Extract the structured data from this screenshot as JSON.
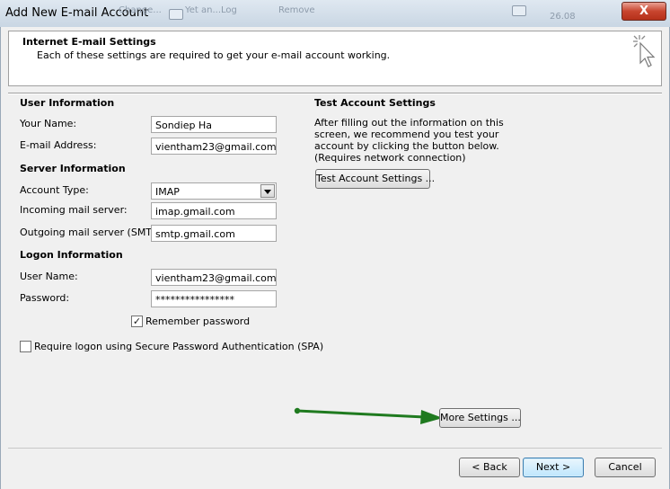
{
  "window": {
    "title": "Add New E-mail Account",
    "close_label": "X"
  },
  "background_ghost": {
    "items": [
      "Change...",
      "Yet an...Log",
      "Remove",
      "26.08"
    ]
  },
  "header": {
    "title": "Internet E-mail Settings",
    "subtitle": "Each of these settings are required to get your e-mail account working."
  },
  "user_info": {
    "heading": "User Information",
    "name_label": "Your Name:",
    "name_value": "Sondiep Ha",
    "email_label": "E-mail Address:",
    "email_value": "vientham23@gmail.com"
  },
  "server_info": {
    "heading": "Server Information",
    "account_type_label": "Account Type:",
    "account_type_value": "IMAP",
    "incoming_label": "Incoming mail server:",
    "incoming_value": "imap.gmail.com",
    "outgoing_label": "Outgoing mail server (SMTP):",
    "outgoing_value": "smtp.gmail.com"
  },
  "logon_info": {
    "heading": "Logon Information",
    "username_label": "User Name:",
    "username_value": "vientham23@gmail.com",
    "password_label": "Password:",
    "password_value": "****************",
    "remember_label": "Remember password",
    "remember_checked": true,
    "spa_label": "Require logon using Secure Password Authentication (SPA)",
    "spa_checked": false
  },
  "test_settings": {
    "heading": "Test Account Settings",
    "description": "After filling out the information on this screen, we recommend you test your account by clicking the button below. (Requires network connection)",
    "button_label": "Test Account Settings ..."
  },
  "more_settings_label": "More Settings ...",
  "footer": {
    "back_label": "< Back",
    "next_label": "Next >",
    "cancel_label": "Cancel"
  },
  "colors": {
    "annotation_arrow": "#1f7a1f",
    "primary_border": "#3c7fb1",
    "close_button": "#c8452e"
  },
  "checkmark_glyph": "✓"
}
